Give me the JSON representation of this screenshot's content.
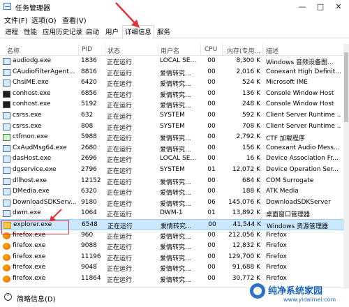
{
  "window": {
    "title": "任务管理器",
    "controls": [
      "—",
      "□",
      "✕"
    ]
  },
  "menu": [
    "文件(F)",
    "选项(O)",
    "查看(V)"
  ],
  "tabs": [
    "进程",
    "性能",
    "应用历史记录",
    "启动",
    "用户",
    "详细信息",
    "服务"
  ],
  "active_tab": "详细信息",
  "columns": [
    "名称",
    "PID",
    "状态",
    "用户名",
    "CPU",
    "内存(专用...",
    "描述"
  ],
  "rows": [
    {
      "name": "audiodg.exe",
      "pid": "1836",
      "status": "正在运行",
      "user": "LOCAL SE...",
      "cpu": "00",
      "mem": "8,300 K",
      "desc": "Windows 音频设备图...",
      "icon": "blue-app-icon"
    },
    {
      "name": "CAudioFilterAgent...",
      "pid": "8816",
      "status": "正在运行",
      "user": "爱情转究...",
      "cpu": "00",
      "mem": "2,016 K",
      "desc": "Conexant High Definit...",
      "icon": "blue-app-icon"
    },
    {
      "name": "ChsIME.exe",
      "pid": "6420",
      "status": "正在运行",
      "user": "爱情转究...",
      "cpu": "00",
      "mem": "524 K",
      "desc": "Microsoft IME",
      "icon": "blue-app-icon"
    },
    {
      "name": "conhost.exe",
      "pid": "6856",
      "status": "正在运行",
      "user": "爱情转究...",
      "cpu": "00",
      "mem": "136 K",
      "desc": "Console Window Host",
      "icon": "console-icon"
    },
    {
      "name": "conhost.exe",
      "pid": "5192",
      "status": "正在运行",
      "user": "爱情转究...",
      "cpu": "00",
      "mem": "248 K",
      "desc": "Console Window Host",
      "icon": "console-icon"
    },
    {
      "name": "csrss.exe",
      "pid": "632",
      "status": "正在运行",
      "user": "SYSTEM",
      "cpu": "00",
      "mem": "592 K",
      "desc": "Client Server Runtime ...",
      "icon": "blue-app-icon"
    },
    {
      "name": "csrss.exe",
      "pid": "808",
      "status": "正在运行",
      "user": "SYSTEM",
      "cpu": "00",
      "mem": "708 K",
      "desc": "Client Server Runtime ...",
      "icon": "blue-app-icon"
    },
    {
      "name": "ctfmon.exe",
      "pid": "5988",
      "status": "正在运行",
      "user": "爱情转究...",
      "cpu": "00",
      "mem": "2,792 K",
      "desc": "CTF 加载程序",
      "icon": "green-app-icon"
    },
    {
      "name": "CxAudMsg64.exe",
      "pid": "2680",
      "status": "正在运行",
      "user": "爱情转究...",
      "cpu": "00",
      "mem": "156 K",
      "desc": "Conexant Audio Mess...",
      "icon": "blue-app-icon"
    },
    {
      "name": "dasHost.exe",
      "pid": "2696",
      "status": "正在运行",
      "user": "LOCAL SE...",
      "cpu": "00",
      "mem": "16 K",
      "desc": "Device Association Fr...",
      "icon": "blue-app-icon"
    },
    {
      "name": "dgservice.exe",
      "pid": "2796",
      "status": "正在运行",
      "user": "SYSTEM",
      "cpu": "01",
      "mem": "12,072 K",
      "desc": "Device Operation Ser...",
      "icon": "blue-app-icon"
    },
    {
      "name": "dllhost.exe",
      "pid": "12152",
      "status": "正在运行",
      "user": "爱情转究...",
      "cpu": "00",
      "mem": "684 K",
      "desc": "COM Surrogate",
      "icon": "blue-app-icon"
    },
    {
      "name": "DMedia.exe",
      "pid": "6320",
      "status": "正在运行",
      "user": "爱情转究...",
      "cpu": "00",
      "mem": "188 K",
      "desc": "ATK Media",
      "icon": "blue-app-icon"
    },
    {
      "name": "DownloadSDKServ...",
      "pid": "9180",
      "status": "正在运行",
      "user": "爱情转究...",
      "cpu": "06",
      "mem": "145,076 K",
      "desc": "DownloadSDKServer",
      "icon": "blue-app-icon"
    },
    {
      "name": "dwm.exe",
      "pid": "1064",
      "status": "正在运行",
      "user": "DWM-1",
      "cpu": "01",
      "mem": "13,892 K",
      "desc": "桌面窗口管理器",
      "icon": "blue-app-icon"
    },
    {
      "name": "explorer.exe",
      "pid": "6548",
      "status": "正在运行",
      "user": "爱情转究...",
      "cpu": "00",
      "mem": "41,544 K",
      "desc": "Windows 资源管理器",
      "icon": "folder-icon",
      "selected": true
    },
    {
      "name": "firefox.exe",
      "pid": "960",
      "status": "正在运行",
      "user": "爱情转究...",
      "cpu": "00",
      "mem": "212,056 K",
      "desc": "Firefox",
      "icon": "firefox-icon"
    },
    {
      "name": "firefox.exe",
      "pid": "9088",
      "status": "正在运行",
      "user": "爱情转究...",
      "cpu": "00",
      "mem": "12,832 K",
      "desc": "Firefox",
      "icon": "firefox-icon"
    },
    {
      "name": "firefox.exe",
      "pid": "11196",
      "status": "正在运行",
      "user": "爱情转究...",
      "cpu": "00",
      "mem": "129,700 K",
      "desc": "Firefox",
      "icon": "firefox-icon"
    },
    {
      "name": "firefox.exe",
      "pid": "9048",
      "status": "正在运行",
      "user": "爱情转究...",
      "cpu": "00",
      "mem": "91,688 K",
      "desc": "Firefox",
      "icon": "firefox-icon"
    },
    {
      "name": "firefox.exe",
      "pid": "11864",
      "status": "正在运行",
      "user": "爱情转究...",
      "cpu": "00",
      "mem": "30,772 K",
      "desc": "Firefox",
      "icon": "firefox-icon"
    }
  ],
  "status_bar": {
    "label": "简略信息(D)"
  },
  "watermark": {
    "title": "纯净系统家园",
    "url": "www.yidaimei.com"
  },
  "colors": {
    "selection": "#cce8ff",
    "annotation": "#e0343a",
    "watermark": "#1d64b8"
  }
}
